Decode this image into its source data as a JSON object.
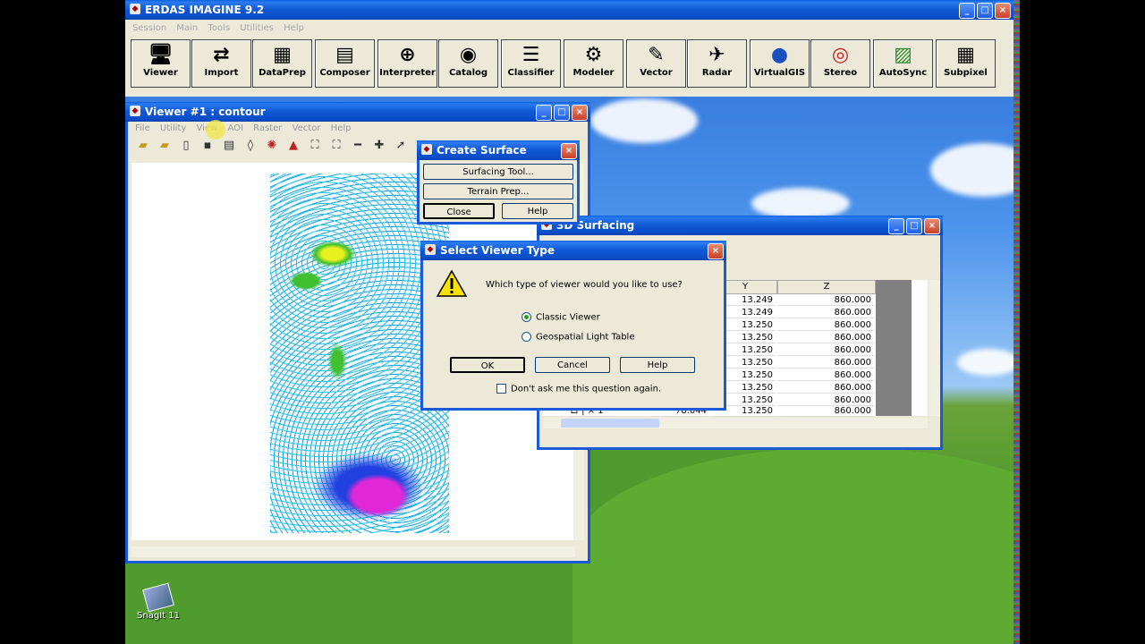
{
  "main_window": {
    "title": "ERDAS IMAGINE 9.2",
    "menu": [
      "Session",
      "Main",
      "Tools",
      "Utilities",
      "Help"
    ],
    "toolbar": [
      {
        "label": "Viewer",
        "icon": "viewer-icon"
      },
      {
        "label": "Import",
        "icon": "import-icon"
      },
      {
        "label": "DataPrep",
        "icon": "dataprep-icon"
      },
      {
        "label": "Composer",
        "icon": "composer-icon"
      },
      {
        "label": "Interpreter",
        "icon": "interpreter-icon"
      },
      {
        "label": "Catalog",
        "icon": "catalog-icon"
      },
      {
        "label": "Classifier",
        "icon": "classifier-icon"
      },
      {
        "label": "Modeler",
        "icon": "modeler-icon"
      },
      {
        "label": "Vector",
        "icon": "vector-icon"
      },
      {
        "label": "Radar",
        "icon": "radar-icon"
      },
      {
        "label": "VirtualGIS",
        "icon": "globe-icon"
      },
      {
        "label": "Stereo",
        "icon": "stereo-icon"
      },
      {
        "label": "AutoSync",
        "icon": "autosync-icon"
      },
      {
        "label": "Subpixel",
        "icon": "subpixel-icon"
      }
    ]
  },
  "viewer": {
    "title": "Viewer #1 : contour",
    "menu": [
      "File",
      "Utility",
      "View",
      "AOI",
      "Raster",
      "Vector",
      "Help"
    ]
  },
  "create_surface": {
    "title": "Create Surface",
    "surfacing_tool": "Surfacing Tool...",
    "terrain_prep": "Terrain Prep...",
    "close": "Close",
    "help": "Help"
  },
  "surfacing": {
    "title": "3D Surfacing",
    "columns": [
      "Y",
      "Z"
    ],
    "rows": [
      {
        "y": "13.249",
        "z": "860.000"
      },
      {
        "y": "13.249",
        "z": "860.000"
      },
      {
        "y": "13.250",
        "z": "860.000"
      },
      {
        "y": "13.250",
        "z": "860.000"
      },
      {
        "y": "13.250",
        "z": "860.000"
      },
      {
        "y": "13.250",
        "z": "860.000"
      },
      {
        "y": "13.250",
        "z": "860.000"
      },
      {
        "y": "13.250",
        "z": "860.000"
      },
      {
        "y": "13.250",
        "z": "860.000"
      },
      {
        "y": "13.250",
        "z": "860.000"
      }
    ],
    "last_row_label": "ㄖ | × 1",
    "last_row_x": "78.044"
  },
  "select_viewer": {
    "title": "Select Viewer Type",
    "question": "Which type of viewer would you like to use?",
    "option_classic": "Classic Viewer",
    "option_geospatial": "Geospatial Light Table",
    "ok": "OK",
    "cancel": "Cancel",
    "help": "Help",
    "dont_ask": "Don't ask me this question again."
  },
  "desktop_icon": {
    "label": "SnagIt 11"
  },
  "colors": {
    "xp_blue": "#0a5fe0",
    "dialog_bg": "#ece9d8",
    "close_red": "#c8422a"
  }
}
